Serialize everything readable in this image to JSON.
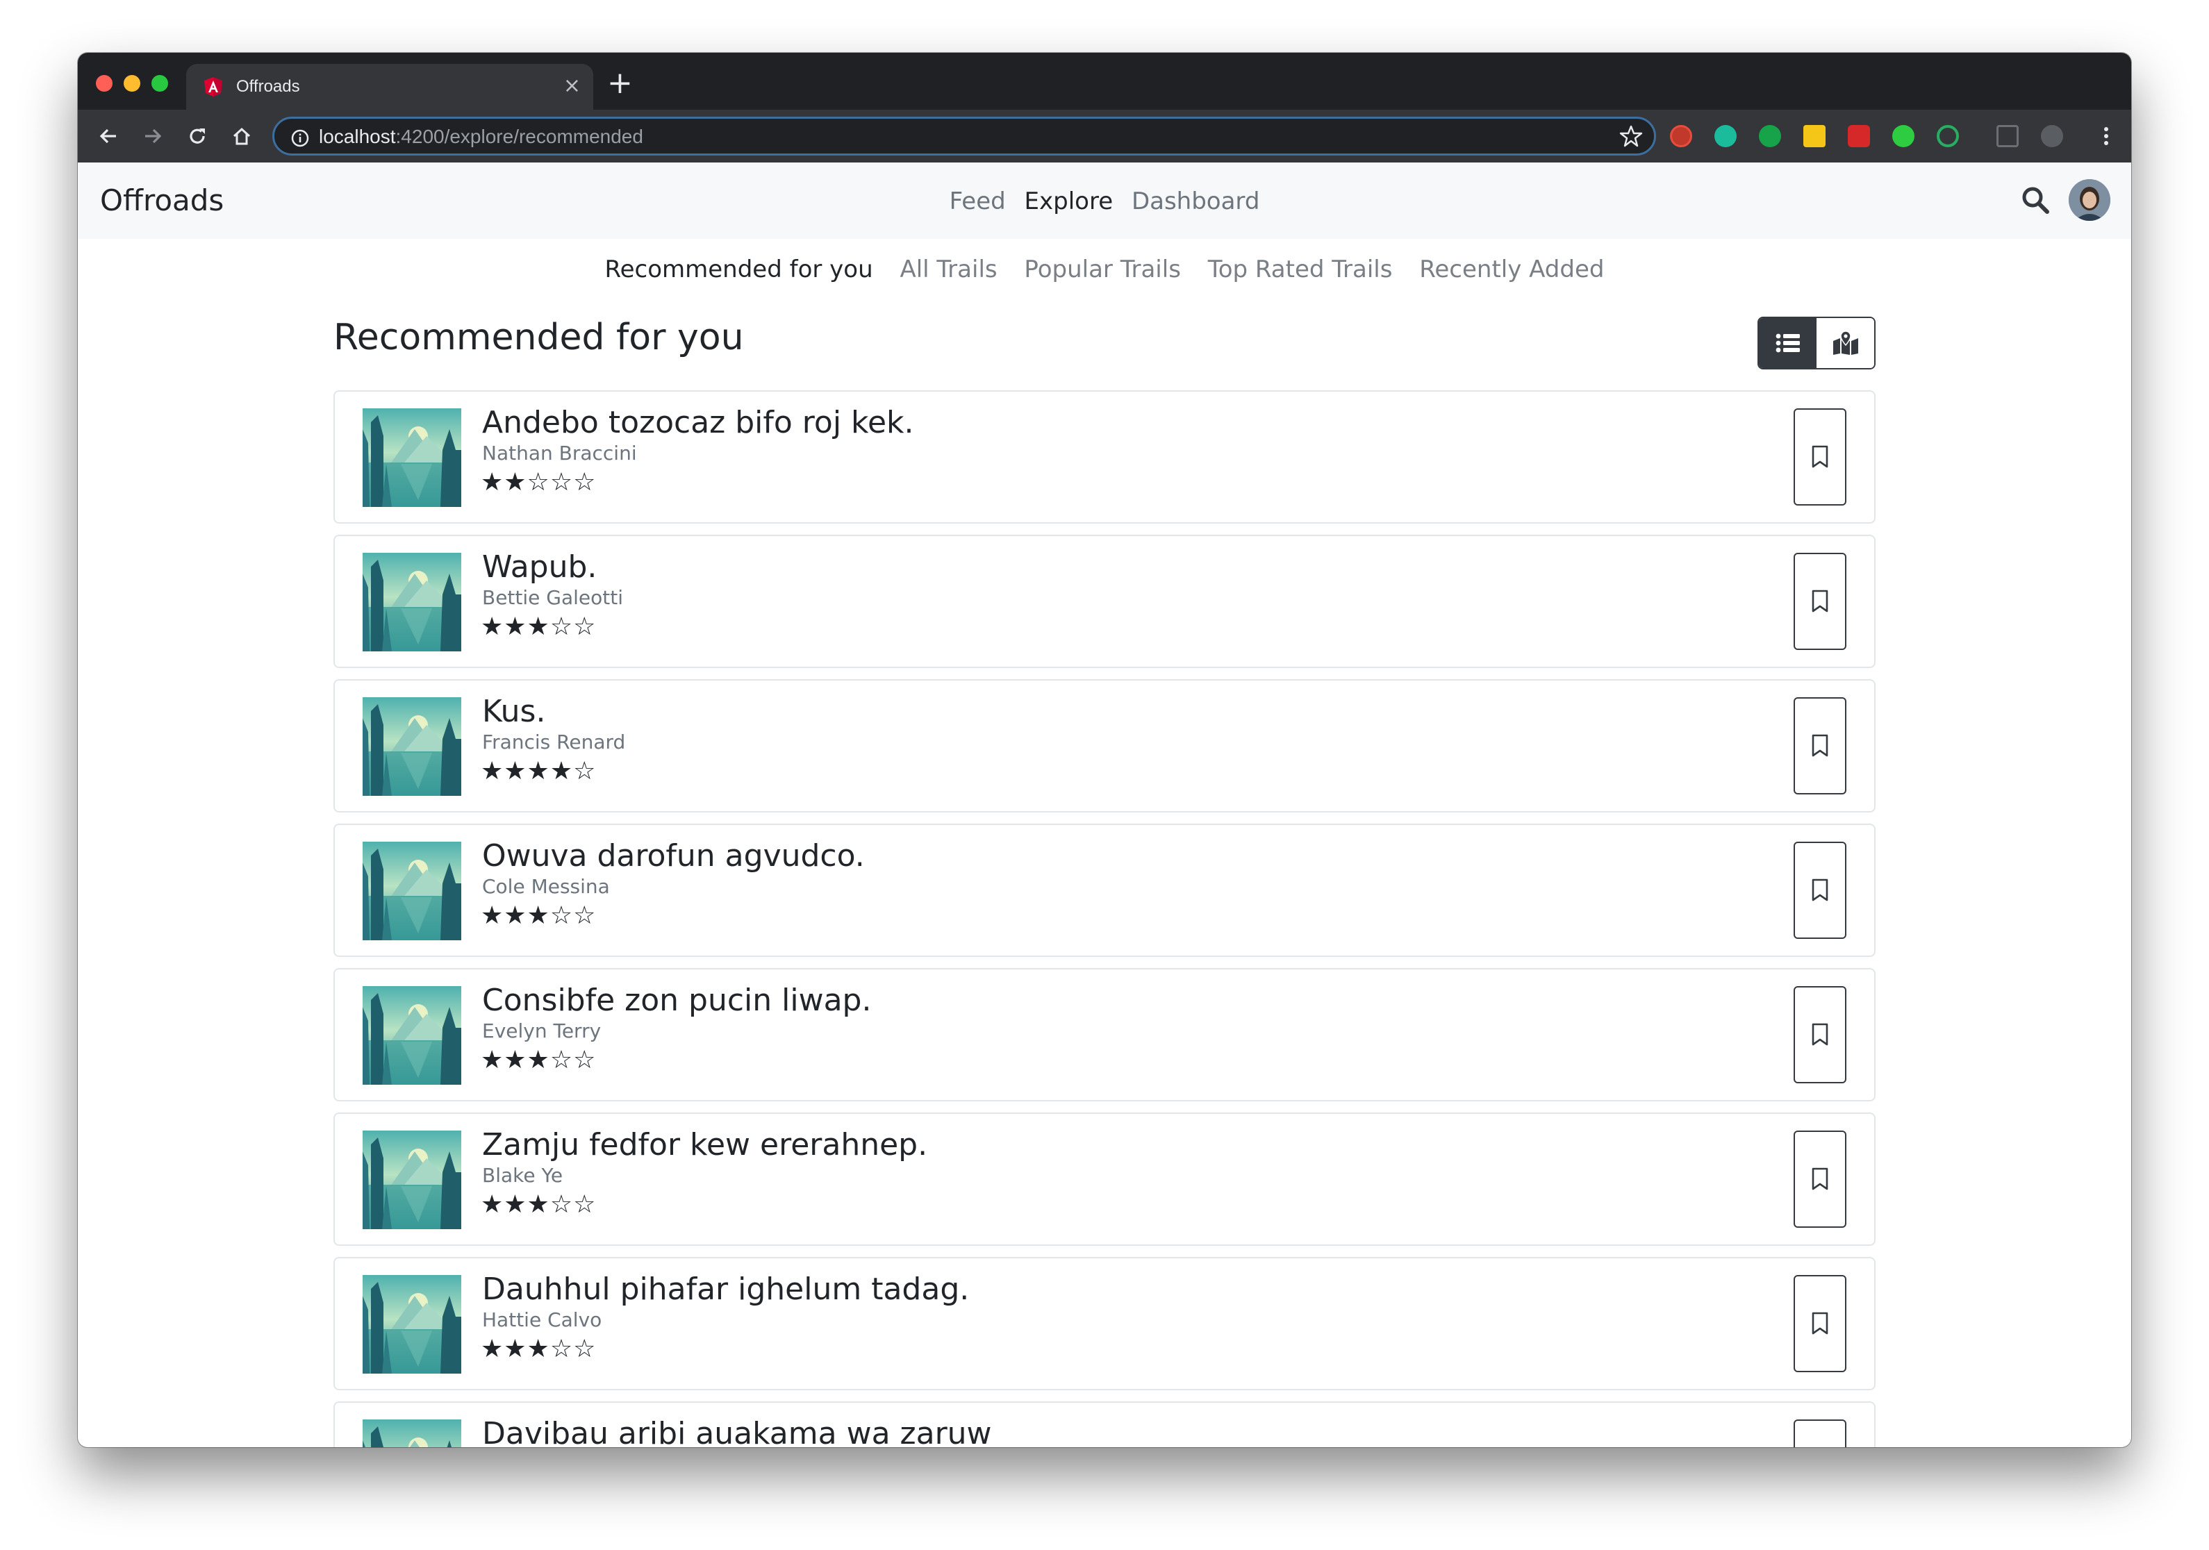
{
  "browser": {
    "tab_title": "Offroads",
    "tab_close": "×",
    "new_tab": "+",
    "url_host": "localhost",
    "url_path": ":4200/explore/recommended"
  },
  "app": {
    "brand": "Offroads",
    "nav": [
      "Feed",
      "Explore",
      "Dashboard"
    ],
    "nav_active": "Explore"
  },
  "subnav": {
    "items": [
      "Recommended for you",
      "All Trails",
      "Popular Trails",
      "Top Rated Trails",
      "Recently Added"
    ],
    "active": "Recommended for you"
  },
  "page": {
    "title": "Recommended for you",
    "view_mode": "list"
  },
  "trails": [
    {
      "name": "Andebo tozocaz bifo roj kek.",
      "author": "Nathan Braccini",
      "rating": 2,
      "stars": "★★☆☆☆"
    },
    {
      "name": "Wapub.",
      "author": "Bettie Galeotti",
      "rating": 3,
      "stars": "★★★☆☆"
    },
    {
      "name": "Kus.",
      "author": "Francis Renard",
      "rating": 4,
      "stars": "★★★★☆"
    },
    {
      "name": "Owuva darofun agvudco.",
      "author": "Cole Messina",
      "rating": 3,
      "stars": "★★★☆☆"
    },
    {
      "name": "Consibfe zon pucin liwap.",
      "author": "Evelyn Terry",
      "rating": 3,
      "stars": "★★★☆☆"
    },
    {
      "name": "Zamju fedfor kew ererahnep.",
      "author": "Blake Ye",
      "rating": 3,
      "stars": "★★★☆☆"
    },
    {
      "name": "Dauhhul pihafar ighelum tadag.",
      "author": "Hattie Calvo",
      "rating": 3,
      "stars": "★★★☆☆"
    },
    {
      "name": "Davibau aribi auakama wa zaruw",
      "author": "",
      "rating": 0,
      "stars": ""
    }
  ],
  "colors": {
    "dark": "#343a40",
    "muted": "#6c757d",
    "text": "#212529",
    "navbar_bg": "#f7f8f9"
  }
}
